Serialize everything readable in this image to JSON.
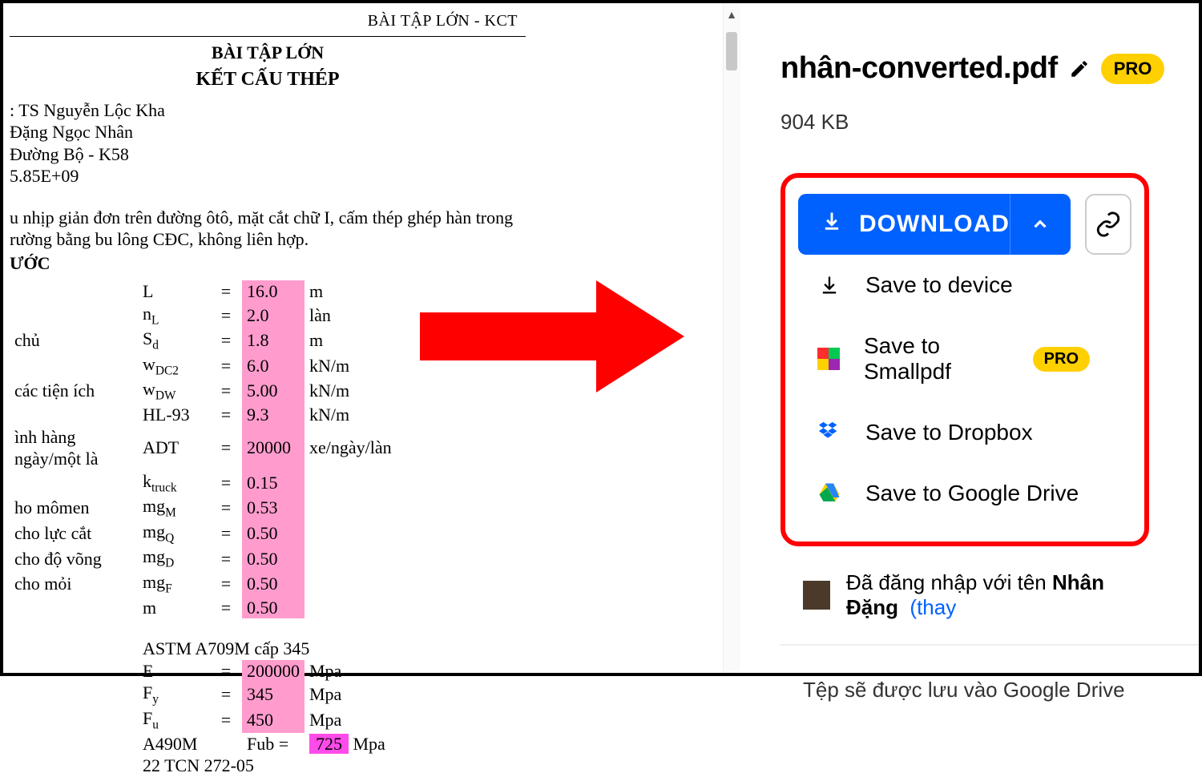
{
  "doc": {
    "header": "BÀI TẬP LỚN - KCT",
    "title1": "BÀI TẬP LỚN",
    "title2": "KẾT CẤU THÉP",
    "info1": ": TS Nguyễn Lộc Kha",
    "info2": "Đặng Ngọc Nhân",
    "info3": "Đường Bộ - K58",
    "info4": "5.85E+09",
    "desc1": "u nhịp giản đơn trên đường ôtô, mặt cắt chữ I, cấm thép ghép hàn trong",
    "desc2": "rường bằng bu lông CĐC, không liên hợp.",
    "section": "ƯỚC",
    "rows": [
      {
        "lbl": "",
        "sym": "L",
        "eq": "=",
        "val": "16.0",
        "unit": "m",
        "hl": true
      },
      {
        "lbl": "",
        "sym": "n<sub>L</sub>",
        "eq": "=",
        "val": "2.0",
        "unit": "làn",
        "hl": true
      },
      {
        "lbl": "chủ",
        "sym": "S<sub>d</sub>",
        "eq": "=",
        "val": "1.8",
        "unit": "m",
        "hl": true
      },
      {
        "lbl": "",
        "sym": "w<sub>DC2</sub>",
        "eq": "=",
        "val": "6.0",
        "unit": "kN/m",
        "hl": true
      },
      {
        "lbl": "các tiện ích",
        "sym": "w<sub>DW</sub>",
        "eq": "=",
        "val": "5.00",
        "unit": "kN/m",
        "hl": true
      },
      {
        "lbl": "",
        "sym": "HL-93",
        "eq": "=",
        "val": "9.3",
        "unit": "kN/m",
        "hl": true
      },
      {
        "lbl": "ình hàng ngày/một là",
        "sym": "ADT",
        "eq": "=",
        "val": "20000",
        "unit": "xe/ngày/làn",
        "hl": true
      },
      {
        "lbl": "",
        "sym": "k<sub>truck</sub>",
        "eq": "=",
        "val": "0.15",
        "unit": "",
        "hl": true
      },
      {
        "lbl": "ho mômen",
        "sym": "mg<sub>M</sub>",
        "eq": "=",
        "val": "0.53",
        "unit": "",
        "hl": true
      },
      {
        "lbl": "cho lực cắt",
        "sym": "mg<sub>Q</sub>",
        "eq": "=",
        "val": "0.50",
        "unit": "",
        "hl": true
      },
      {
        "lbl": "cho độ võng",
        "sym": "mg<sub>D</sub>",
        "eq": "=",
        "val": "0.50",
        "unit": "",
        "hl": true
      },
      {
        "lbl": "cho mỏi",
        "sym": "mg<sub>F</sub>",
        "eq": "=",
        "val": "0.50",
        "unit": "",
        "hl": true
      },
      {
        "lbl": "",
        "sym": "m",
        "eq": "=",
        "val": "0.50",
        "unit": "",
        "hl": true
      }
    ],
    "astm_header": "ASTM A709M cấp 345",
    "astm_rows": [
      {
        "sym": "E",
        "eq": "=",
        "val": "200000",
        "unit": "Mpa",
        "hl": true
      },
      {
        "sym": "F<sub>y</sub>",
        "eq": "=",
        "val": "345",
        "unit": "Mpa",
        "hl": true
      },
      {
        "sym": "F<sub>u</sub>",
        "eq": "=",
        "val": "450",
        "unit": "Mpa",
        "hl": true
      }
    ],
    "a490": {
      "sym": "A490M",
      "eq": "Fub =",
      "val": "725",
      "unit": "Mpa"
    },
    "tcn": "22 TCN 272-05"
  },
  "panel": {
    "filename": "nhân-converted.pdf",
    "pro": "PRO",
    "size": "904 KB",
    "download": "DOWNLOAD",
    "opts": {
      "device": "Save to device",
      "smallpdf": "Save to Smallpdf",
      "dropbox": "Save to Dropbox",
      "gdrive": "Save to Google Drive"
    },
    "user": {
      "prefix": "Đã đăng nhập với tên ",
      "name": "Nhân Đặng",
      "thay": "(thay"
    },
    "gdline": "Tệp sẽ được lưu vào Google Drive"
  }
}
